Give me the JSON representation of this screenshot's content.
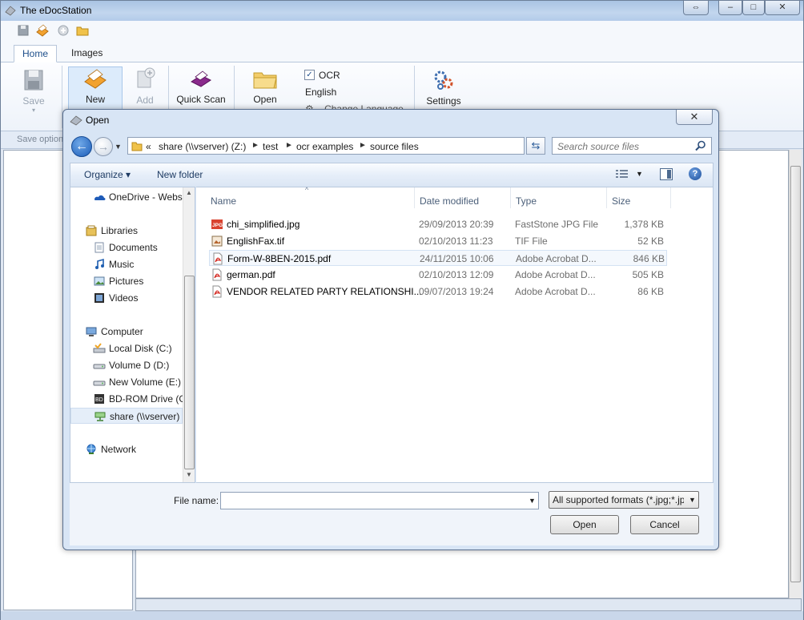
{
  "app": {
    "title": "The eDocStation",
    "tabs": [
      {
        "label": "Home"
      },
      {
        "label": "Images"
      }
    ],
    "ribbon": {
      "save": "Save",
      "new_document": "New Document",
      "add": "Add",
      "quick_scan": "Quick Scan & Go",
      "open": "Open",
      "ocr_label": "OCR",
      "ocr_checked": true,
      "language": "English",
      "change_language": "Change Language",
      "settings": "Settings"
    },
    "save_options": "Save options"
  },
  "dialog": {
    "title": "Open",
    "close_glyph": "✕",
    "breadcrumb": [
      "share (\\\\vserver) (Z:)",
      "test",
      "ocr examples",
      "source files"
    ],
    "breadcrumb_overflow": "«",
    "search_placeholder": "Search source files",
    "toolbar": {
      "organize": "Organize ▾",
      "new_folder": "New folder"
    },
    "nav": [
      {
        "label": "OneDrive - Webs",
        "icon": "onedrive-icon",
        "indent": 1
      },
      {
        "label": "Libraries",
        "icon": "libraries-icon",
        "indent": 0
      },
      {
        "label": "Documents",
        "icon": "documents-icon",
        "indent": 1
      },
      {
        "label": "Music",
        "icon": "music-icon",
        "indent": 1
      },
      {
        "label": "Pictures",
        "icon": "pictures-icon",
        "indent": 1
      },
      {
        "label": "Videos",
        "icon": "videos-icon",
        "indent": 1
      },
      {
        "label": "Computer",
        "icon": "computer-icon",
        "indent": 0
      },
      {
        "label": "Local Disk (C:)",
        "icon": "local-disk-icon",
        "indent": 1
      },
      {
        "label": "Volume D (D:)",
        "icon": "drive-icon",
        "indent": 1
      },
      {
        "label": "New Volume (E:)",
        "icon": "drive-icon",
        "indent": 1
      },
      {
        "label": "BD-ROM Drive (G",
        "icon": "bd-rom-icon",
        "indent": 1
      },
      {
        "label": "share (\\\\vserver)",
        "icon": "network-drive-icon",
        "indent": 1,
        "selected": true
      },
      {
        "label": "Network",
        "icon": "network-icon",
        "indent": 0
      }
    ],
    "columns": {
      "name": "Name",
      "date": "Date modified",
      "type": "Type",
      "size": "Size"
    },
    "files": [
      {
        "name": "chi_simplified.jpg",
        "date": "29/09/2013 20:39",
        "type": "FastStone JPG File",
        "size": "1,378 KB",
        "icon": "jpg-file-icon"
      },
      {
        "name": "EnglishFax.tif",
        "date": "02/10/2013 11:23",
        "type": "TIF File",
        "size": "52 KB",
        "icon": "tif-file-icon"
      },
      {
        "name": "Form-W-8BEN-2015.pdf",
        "date": "24/11/2015 10:06",
        "type": "Adobe Acrobat D...",
        "size": "846 KB",
        "icon": "pdf-file-icon",
        "highlighted": true
      },
      {
        "name": "german.pdf",
        "date": "02/10/2013 12:09",
        "type": "Adobe Acrobat D...",
        "size": "505 KB",
        "icon": "pdf-file-icon"
      },
      {
        "name": "VENDOR RELATED PARTY RELATIONSHI...",
        "date": "09/07/2013 19:24",
        "type": "Adobe Acrobat D...",
        "size": "86 KB",
        "icon": "pdf-file-icon"
      }
    ],
    "file_name_label": "File name:",
    "file_name_value": "",
    "filter": "All supported formats (*.jpg;*.jp",
    "open_button": "Open",
    "cancel_button": "Cancel"
  }
}
